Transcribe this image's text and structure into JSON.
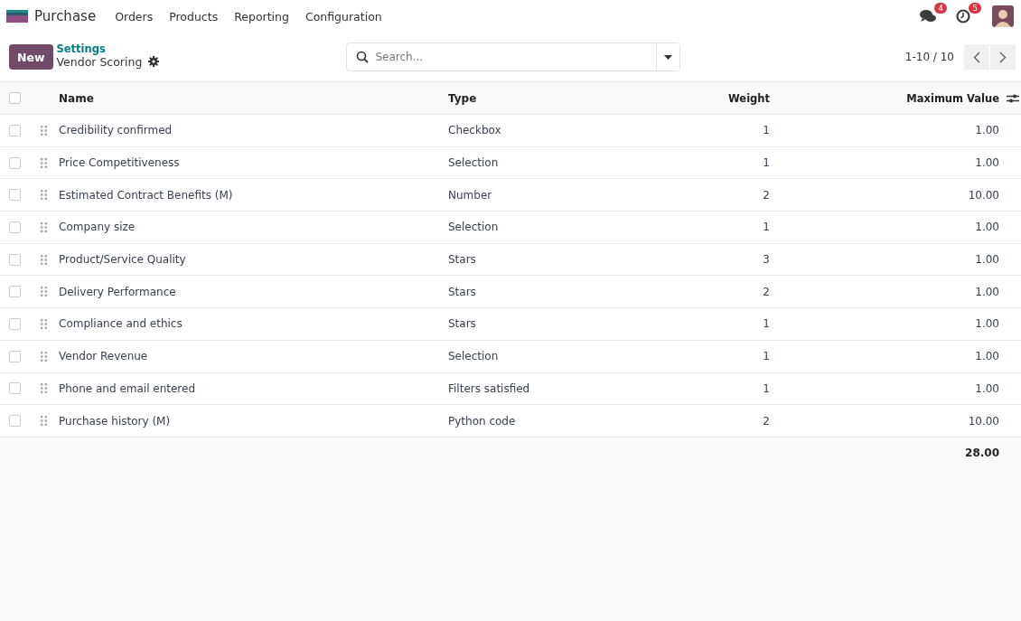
{
  "navbar": {
    "app_name": "Purchase",
    "menu": [
      "Orders",
      "Products",
      "Reporting",
      "Configuration"
    ],
    "messages_badge": "4",
    "activities_badge": "5"
  },
  "control_panel": {
    "new_button": "New",
    "breadcrumb": "Settings",
    "title": "Vendor Scoring",
    "search": {
      "placeholder": "Search..."
    },
    "pager": "1-10 / 10"
  },
  "table": {
    "select_all_checked": false,
    "columns": [
      "Name",
      "Type",
      "Weight",
      "Maximum Value"
    ],
    "rows": [
      {
        "name": "Credibility confirmed",
        "type": "Checkbox",
        "weight": "1",
        "maximum_value": "1.00",
        "checked": false
      },
      {
        "name": "Price Competitiveness",
        "type": "Selection",
        "weight": "1",
        "maximum_value": "1.00",
        "checked": false
      },
      {
        "name": "Estimated Contract Benefits (M)",
        "type": "Number",
        "weight": "2",
        "maximum_value": "10.00",
        "checked": false
      },
      {
        "name": "Company size",
        "type": "Selection",
        "weight": "1",
        "maximum_value": "1.00",
        "checked": false
      },
      {
        "name": "Product/Service Quality",
        "type": "Stars",
        "weight": "3",
        "maximum_value": "1.00",
        "checked": false
      },
      {
        "name": "Delivery Performance",
        "type": "Stars",
        "weight": "2",
        "maximum_value": "1.00",
        "checked": false
      },
      {
        "name": "Compliance and ethics",
        "type": "Stars",
        "weight": "1",
        "maximum_value": "1.00",
        "checked": false
      },
      {
        "name": "Vendor Revenue",
        "type": "Selection",
        "weight": "1",
        "maximum_value": "1.00",
        "checked": false
      },
      {
        "name": "Phone and email entered",
        "type": "Filters satisfied",
        "weight": "1",
        "maximum_value": "1.00",
        "checked": false
      },
      {
        "name": "Purchase history (M)",
        "type": "Python code",
        "weight": "2",
        "maximum_value": "10.00",
        "checked": false
      }
    ],
    "total": "28.00"
  }
}
